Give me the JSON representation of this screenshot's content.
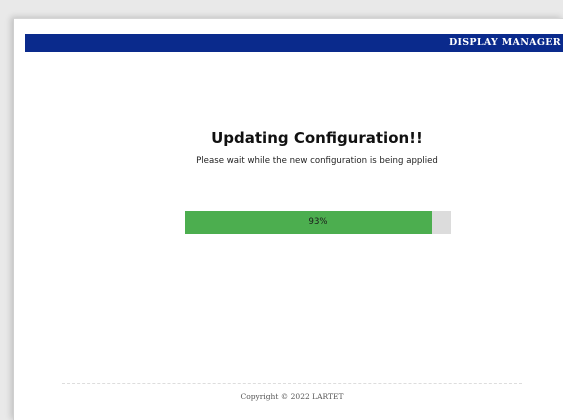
{
  "header": {
    "title": "DISPLAY MANAGER",
    "background_color": "#0a2a8c"
  },
  "main": {
    "heading": "Updating Configuration!!",
    "subtitle": "Please wait while the new configuration is being applied"
  },
  "progress": {
    "label": "93%",
    "value": 0.93,
    "fill_color": "#4cae4f",
    "track_color": "#dcdcdc"
  },
  "footer": {
    "copyright": "Copyright © 2022 LARTET"
  }
}
